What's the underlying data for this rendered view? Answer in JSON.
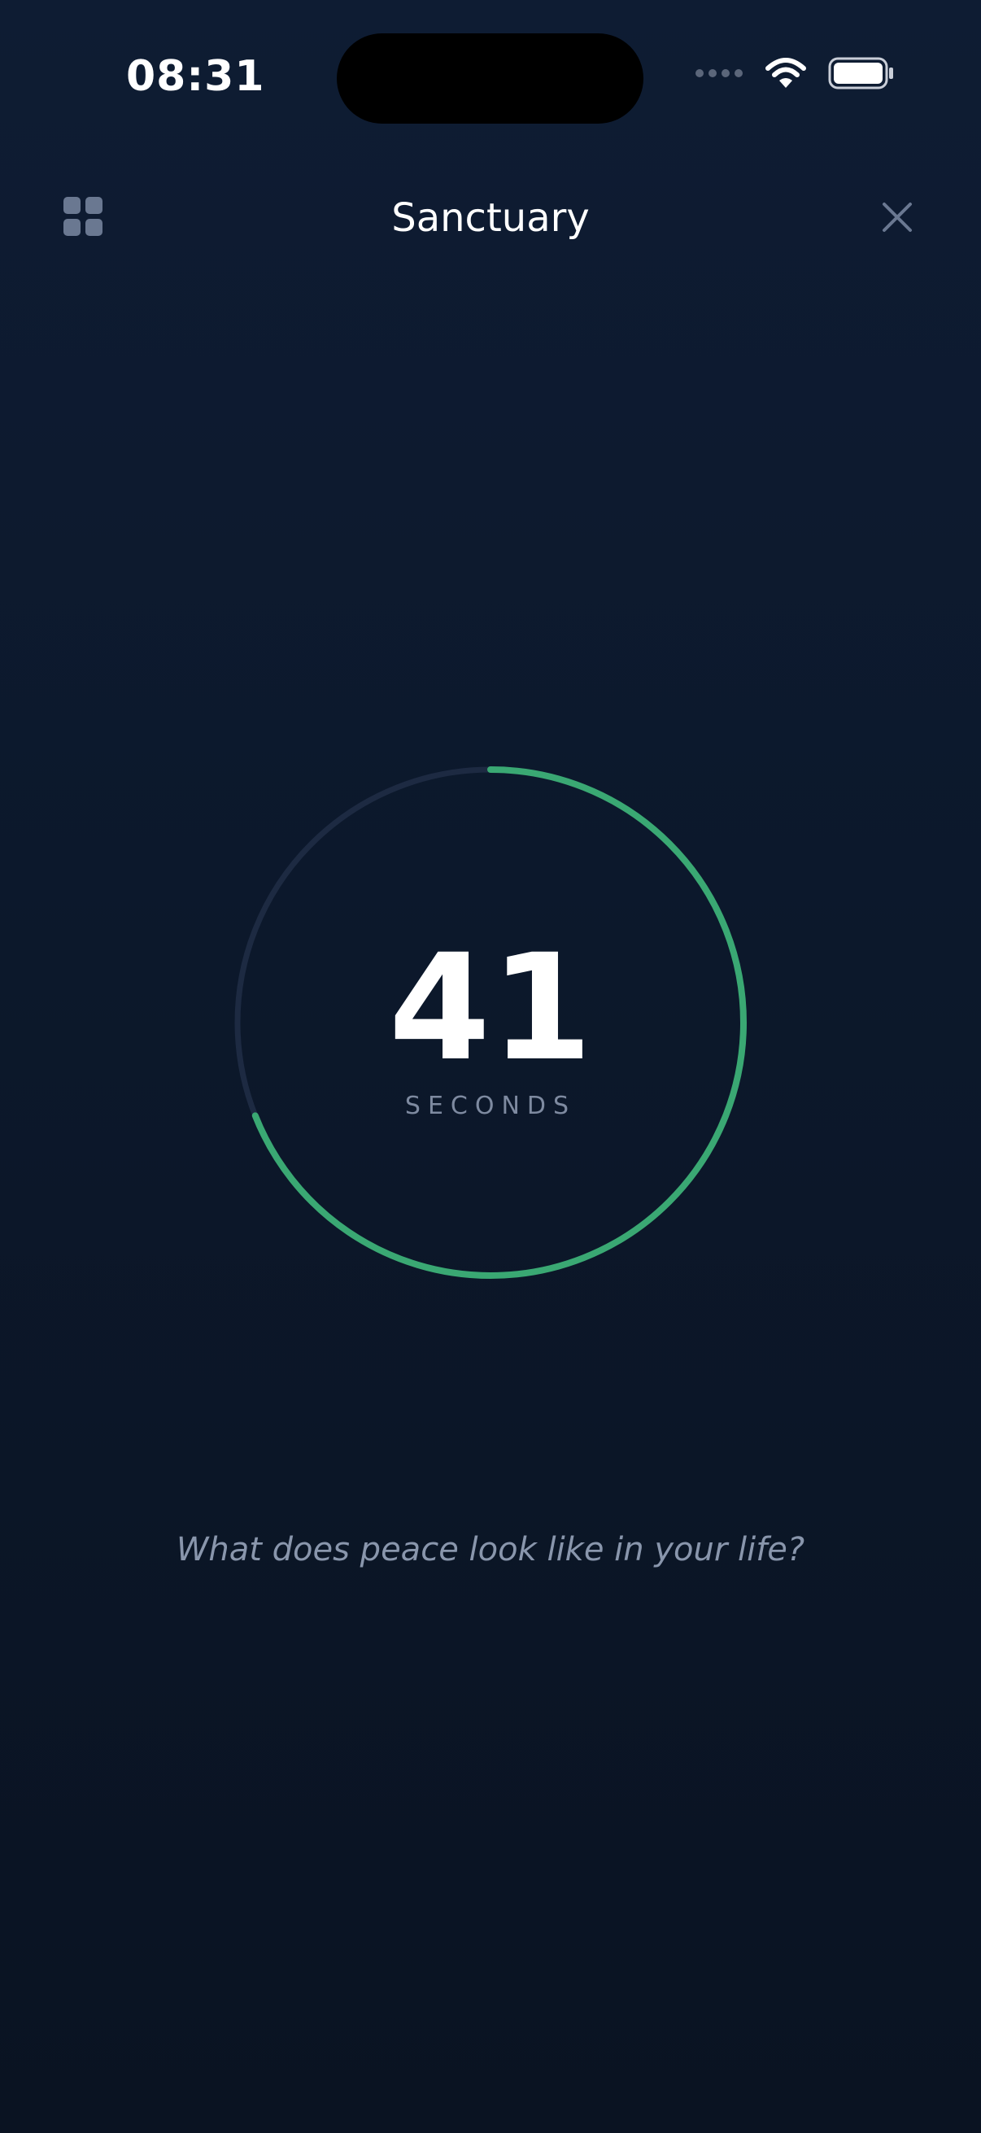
{
  "status_bar": {
    "time": "08:31"
  },
  "header": {
    "title": "Sanctuary"
  },
  "timer": {
    "value": "41",
    "unit": "SECONDS",
    "progress_fraction": 0.69
  },
  "prompt": {
    "text": "What does peace look like in your life?"
  },
  "colors": {
    "background": "#0c182b",
    "accent_green": "#3aa873",
    "ring_track": "#1d2a42",
    "muted_text": "#7e8aa0",
    "icon_gray": "#6a7891"
  },
  "icons": {
    "apps": "grid-icon",
    "close": "close-icon",
    "signal": "signal-icon",
    "wifi": "wifi-icon",
    "battery": "battery-icon"
  }
}
